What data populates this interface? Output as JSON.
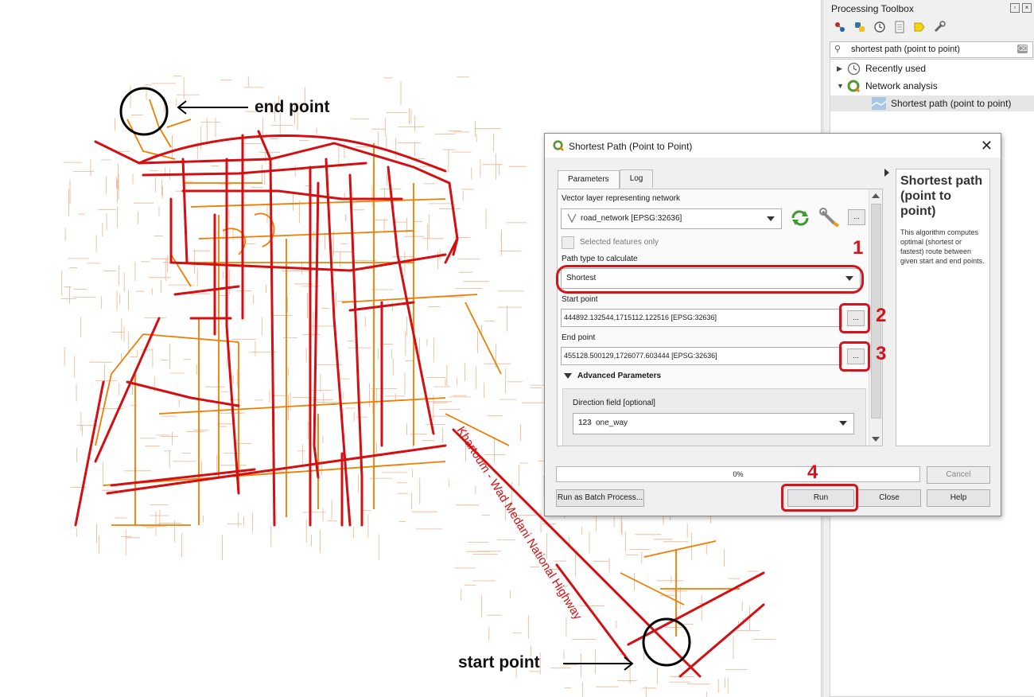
{
  "annotations": {
    "end_point": "end point",
    "start_point": "start point",
    "step1": "1",
    "step2": "2",
    "step3": "3",
    "step4": "4"
  },
  "map": {
    "road_label": "Khartoum - Wad Medani National Highway",
    "colors": {
      "primary": "#d40f12",
      "secondary": "#f07d00",
      "minor": "#e9b48d"
    }
  },
  "toolbox": {
    "title": "Processing Toolbox",
    "search_value": "shortest path (point to point)",
    "tree": [
      {
        "label": "Recently used",
        "icon": "clock-icon"
      },
      {
        "label": "Network analysis",
        "icon": "qgis-icon"
      },
      {
        "label": "Shortest path (point to point)",
        "icon": "algorithm-icon"
      }
    ]
  },
  "dialog": {
    "title": "Shortest Path (Point to Point)",
    "tabs": [
      "Parameters",
      "Log"
    ],
    "network_label": "Vector layer representing network",
    "network_value": "road_network [EPSG:32636]",
    "selected_only": "Selected features only",
    "path_type_label": "Path type to calculate",
    "path_type_value": "Shortest",
    "start_label": "Start point",
    "start_value": "444892.132544,1715112.122516 [EPSG:32636]",
    "end_label": "End point",
    "end_value": "455128.500129,1726077.603444 [EPSG:32636]",
    "ellipsis": "...",
    "advanced": "Advanced Parameters",
    "direction_label": "Direction field [optional]",
    "direction_type": "123",
    "direction_value": "one_way",
    "help_title": "Shortest path (point to point)",
    "help_desc": "This algorithm computes optimal (shortest or fastest) route between given start and end points.",
    "progress": "0%",
    "progress_value": 0,
    "buttons": {
      "batch": "Run as Batch Process...",
      "cancel": "Cancel",
      "run": "Run",
      "close": "Close",
      "help": "Help"
    }
  }
}
